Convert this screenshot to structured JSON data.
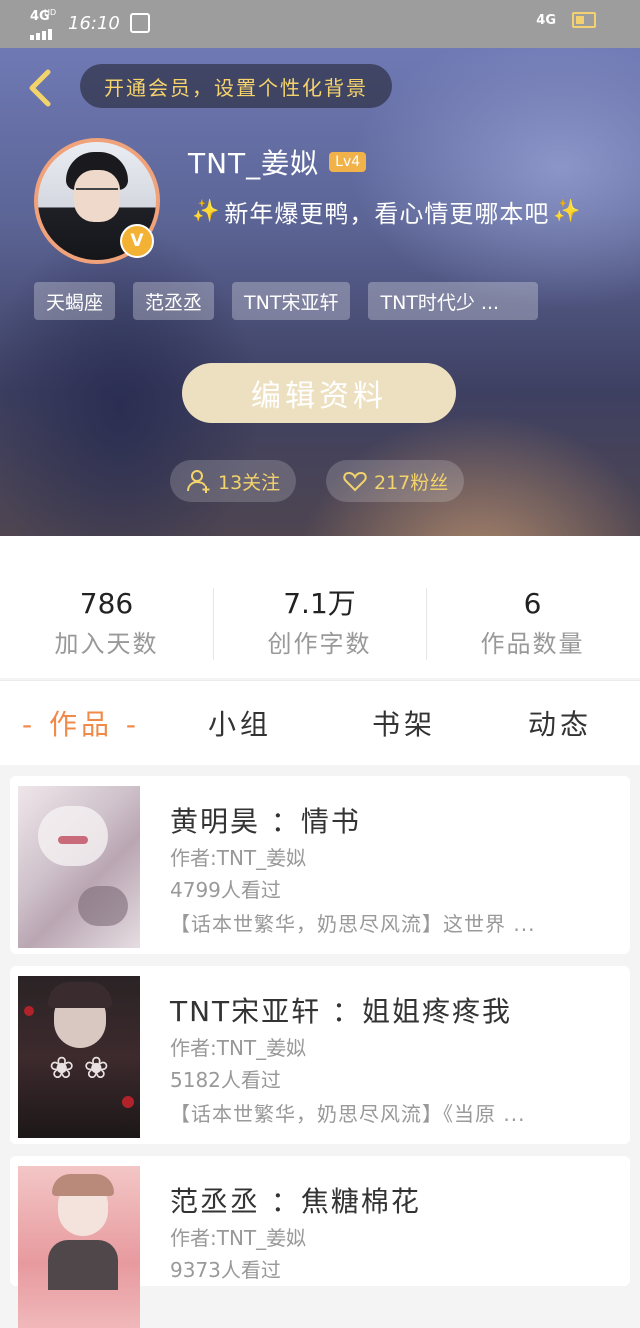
{
  "status_bar": {
    "left_network": "4G",
    "left_network_sup": "HD",
    "time": "16:10",
    "app_icon": "notification-app-icon",
    "right_network": "4G"
  },
  "header": {
    "back_icon": "chevron-left-icon",
    "vip_banner": "开通会员，设置个性化背景",
    "username": "TNT_姜姒",
    "level": "Lv4",
    "verified_badge": "V",
    "signature": "新年爆更鸭，看心情更哪本吧",
    "sparkle": "✨",
    "tags": [
      "天蝎座",
      "范丞丞",
      "TNT宋亚轩",
      "TNT时代少 ..."
    ],
    "edit_button": "编辑资料",
    "follow_count": "13关注",
    "fans_count": "217粉丝"
  },
  "stats": [
    {
      "value": "786",
      "label": "加入天数"
    },
    {
      "value": "7.1万",
      "label": "创作字数"
    },
    {
      "value": "6",
      "label": "作品数量"
    }
  ],
  "tabs": [
    {
      "label": "- 作品 -",
      "active": true
    },
    {
      "label": "小组",
      "active": false
    },
    {
      "label": "书架",
      "active": false
    },
    {
      "label": "动态",
      "active": false
    }
  ],
  "works": [
    {
      "title": "黄明昊 ：情书",
      "author": "作者:TNT_姜姒",
      "views": "4799人看过",
      "desc": "【话本世繁华，奶思尽风流】这世界 ..."
    },
    {
      "title": "TNT宋亚轩 ：姐姐疼疼我",
      "author": "作者:TNT_姜姒",
      "views": "5182人看过",
      "desc": "【话本世繁华，奶思尽风流】《当原 ..."
    },
    {
      "title": "范丞丞 ：焦糖棉花",
      "author": "作者:TNT_姜姒",
      "views": "9373人看过",
      "desc": ""
    }
  ],
  "colors": {
    "accent": "#f08a4b",
    "vip_text": "#f6d36b",
    "edit_button_bg": "#ede0c0",
    "level_badge": "#f2b24a"
  }
}
